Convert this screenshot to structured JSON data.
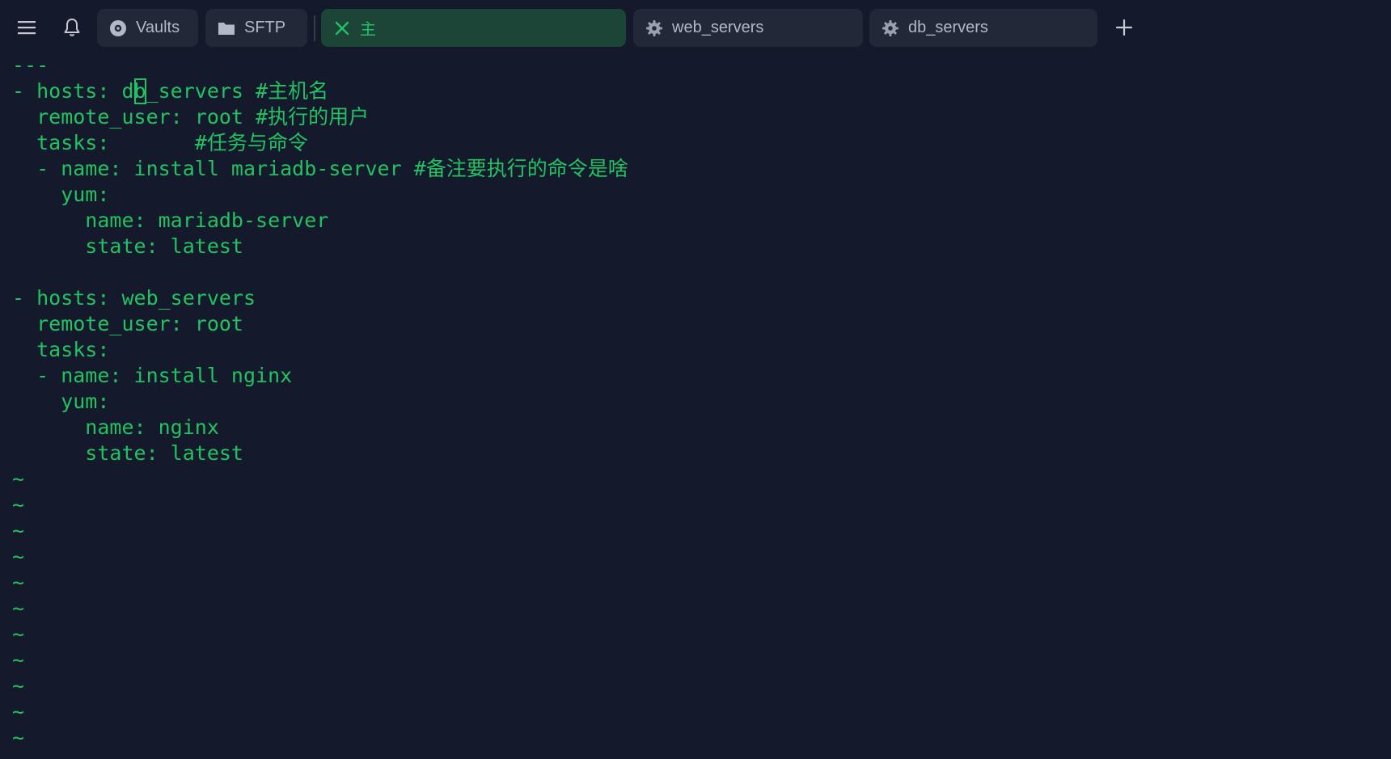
{
  "topbar": {
    "menu_icon": "hamburger-menu-icon",
    "notification_icon": "bell-icon",
    "tabs": [
      {
        "label": "Vaults",
        "icon": "vault-icon",
        "active": false
      },
      {
        "label": "SFTP",
        "icon": "folder-icon",
        "active": false
      },
      {
        "label": "主",
        "icon": "close-icon",
        "active": true
      },
      {
        "label": "web_servers",
        "icon": "gear-icon",
        "active": false
      },
      {
        "label": "db_servers",
        "icon": "gear-icon",
        "active": false
      }
    ],
    "new_tab_icon": "plus-icon"
  },
  "terminal": {
    "lines": [
      "---",
      "- hosts: db_servers #主机名",
      "  remote_user: root #执行的用户",
      "  tasks:       #任务与命令",
      "  - name: install mariadb-server #备注要执行的命令是啥",
      "    yum:",
      "      name: mariadb-server",
      "      state: latest",
      "",
      "- hosts: web_servers",
      "  remote_user: root",
      "  tasks:",
      "  - name: install nginx",
      "    yum:",
      "      name: nginx",
      "      state: latest",
      "~",
      "~",
      "~",
      "~",
      "~",
      "~",
      "~",
      "~",
      "~",
      "~",
      "~"
    ],
    "cursor": {
      "line": 1,
      "column": 10
    }
  },
  "colors": {
    "background": "#141a2b",
    "tab_background": "#232838",
    "active_tab_background": "#1c4537",
    "text_green": "#22c262",
    "tab_text": "#b3b8c6"
  }
}
